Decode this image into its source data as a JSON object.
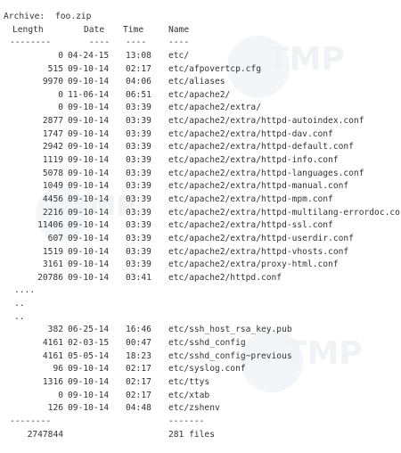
{
  "archive": {
    "label": "Archive:",
    "name": "foo.zip"
  },
  "headers": {
    "length": "Length",
    "date": "Date",
    "time": "Time",
    "name": "Name"
  },
  "header_separators": {
    "length": "--------",
    "date": "----",
    "time": "----",
    "name": "----"
  },
  "rows_top": [
    {
      "length": "0",
      "date": "04-24-15",
      "time": "13:08",
      "name": "etc/"
    },
    {
      "length": "515",
      "date": "09-10-14",
      "time": "02:17",
      "name": "etc/afpovertcp.cfg"
    },
    {
      "length": "9970",
      "date": "09-10-14",
      "time": "04:06",
      "name": "etc/aliases"
    },
    {
      "length": "0",
      "date": "11-06-14",
      "time": "06:51",
      "name": "etc/apache2/"
    },
    {
      "length": "0",
      "date": "09-10-14",
      "time": "03:39",
      "name": "etc/apache2/extra/"
    },
    {
      "length": "2877",
      "date": "09-10-14",
      "time": "03:39",
      "name": "etc/apache2/extra/httpd-autoindex.conf"
    },
    {
      "length": "1747",
      "date": "09-10-14",
      "time": "03:39",
      "name": "etc/apache2/extra/httpd-dav.conf"
    },
    {
      "length": "2942",
      "date": "09-10-14",
      "time": "03:39",
      "name": "etc/apache2/extra/httpd-default.conf"
    },
    {
      "length": "1119",
      "date": "09-10-14",
      "time": "03:39",
      "name": "etc/apache2/extra/httpd-info.conf"
    },
    {
      "length": "5078",
      "date": "09-10-14",
      "time": "03:39",
      "name": "etc/apache2/extra/httpd-languages.conf"
    },
    {
      "length": "1049",
      "date": "09-10-14",
      "time": "03:39",
      "name": "etc/apache2/extra/httpd-manual.conf"
    },
    {
      "length": "4456",
      "date": "09-10-14",
      "time": "03:39",
      "name": "etc/apache2/extra/httpd-mpm.conf"
    },
    {
      "length": "2216",
      "date": "09-10-14",
      "time": "03:39",
      "name": "etc/apache2/extra/httpd-multilang-errordoc.co"
    },
    {
      "length": "11406",
      "date": "09-10-14",
      "time": "03:39",
      "name": "etc/apache2/extra/httpd-ssl.conf"
    },
    {
      "length": "607",
      "date": "09-10-14",
      "time": "03:39",
      "name": "etc/apache2/extra/httpd-userdir.conf"
    },
    {
      "length": "1519",
      "date": "09-10-14",
      "time": "03:39",
      "name": "etc/apache2/extra/httpd-vhosts.conf"
    },
    {
      "length": "3161",
      "date": "09-10-14",
      "time": "03:39",
      "name": "etc/apache2/extra/proxy-html.conf"
    },
    {
      "length": "20786",
      "date": "09-10-14",
      "time": "03:41",
      "name": "etc/apache2/httpd.conf"
    }
  ],
  "ellipsis": [
    "....",
    "..",
    ".."
  ],
  "rows_bottom": [
    {
      "length": "382",
      "date": "06-25-14",
      "time": "16:46",
      "name": "etc/ssh_host_rsa_key.pub"
    },
    {
      "length": "4161",
      "date": "02-03-15",
      "time": "00:47",
      "name": "etc/sshd_config"
    },
    {
      "length": "4161",
      "date": "05-05-14",
      "time": "18:23",
      "name": "etc/sshd_config~previous"
    },
    {
      "length": "96",
      "date": "09-10-14",
      "time": "02:17",
      "name": "etc/syslog.conf"
    },
    {
      "length": "1316",
      "date": "09-10-14",
      "time": "02:17",
      "name": "etc/ttys"
    },
    {
      "length": "0",
      "date": "09-10-14",
      "time": "02:17",
      "name": "etc/xtab"
    },
    {
      "length": "126",
      "date": "09-10-14",
      "time": "04:48",
      "name": "etc/zshenv"
    }
  ],
  "footer_separators": {
    "length": "--------",
    "name": "-------"
  },
  "totals": {
    "length": "2747844",
    "files": "281 files"
  },
  "watermarks": [
    "TMP",
    "TMP",
    "TMP"
  ],
  "colors": {
    "text": "#333333",
    "watermark": "#f1f2f6"
  }
}
